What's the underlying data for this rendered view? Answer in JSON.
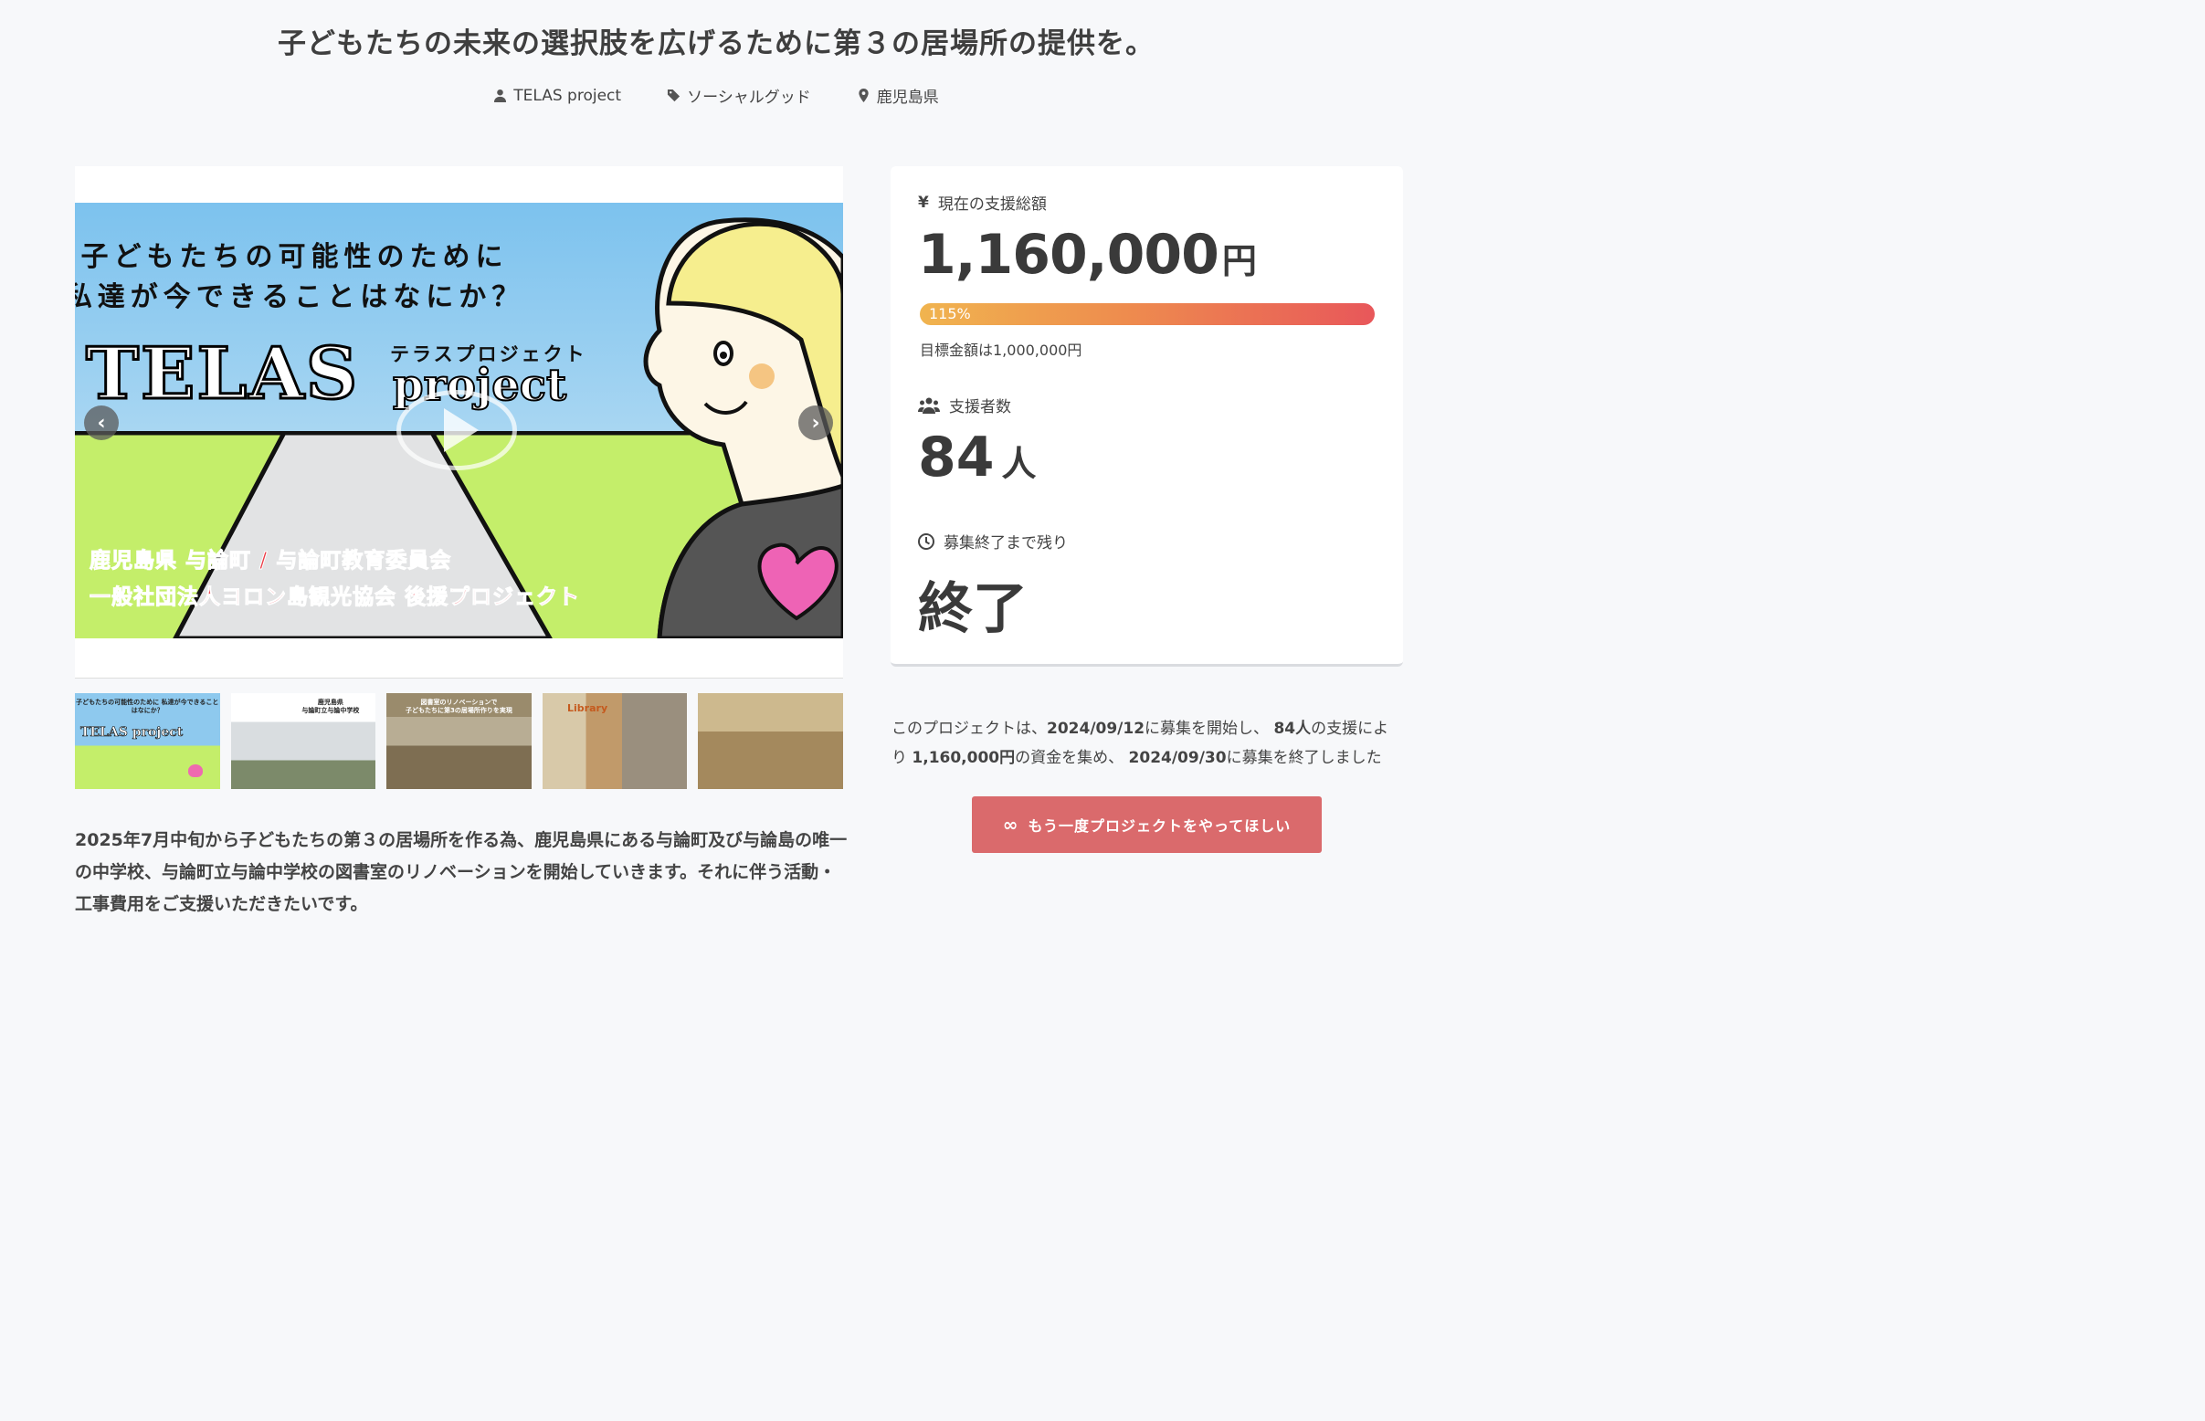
{
  "title": "子どもたちの未来の選択肢を広げるために第３の居場所の提供を。",
  "meta": {
    "owner": "TELAS project",
    "category": "ソーシャルグッド",
    "location": "鹿児島県"
  },
  "hero": {
    "line1": "子どもたちの可能性のために",
    "line2": "私達が今できることはなにか？",
    "logo_big": "TELAS",
    "logo_kana": "テラスプロジェクト",
    "logo_project": "project",
    "red_line1": "鹿児島県 与論町 / 与論町教育委員会",
    "red_line2": "一般社団法人ヨロン島観光協会 後援プロジェクト"
  },
  "thumbnails": {
    "t1_caption": "子どもたちの可能性のために 私達が今できることはなにか？",
    "t1_logo": "TELAS project",
    "t2_caption": "鹿児島県\n与論町立与論中学校",
    "t3_caption": "図書室のリノベーションで\n子どもたちに第3の居場所作りを実現",
    "t4_caption": "Library"
  },
  "description": "2025年7月中旬から子どもたちの第３の居場所を作る為、鹿児島県にある与論町及び与論島の唯一の中学校、与論町立与論中学校の図書室のリノベーションを開始していきます。それに伴う活動・工事費用をご支援いただきたいです。",
  "stats": {
    "amount_label": "現在の支援総額",
    "amount": "1,160,000",
    "amount_unit": "円",
    "progress_text": "115%",
    "progress_percent": 115,
    "goal": "目標金額は1,000,000円",
    "backers_label": "支援者数",
    "backers": "84",
    "backers_unit": "人",
    "remaining_label": "募集終了まで残り",
    "remaining": "終了"
  },
  "summary": {
    "p1": "このプロジェクトは、",
    "start_date": "2024/09/12",
    "p2": "に募集を開始し、",
    "backers": "84人",
    "p3": "の支援により",
    "amount": "1,160,000円",
    "p4": "の資金を集め、",
    "end_date": "2024/09/30",
    "p5": "に募集を終了しました"
  },
  "again_button": {
    "icon": "∞",
    "label": "もう一度プロジェクトをやってほしい"
  },
  "icons": {
    "owner": "user-icon",
    "category": "tag-icon",
    "location": "map-pin-icon",
    "amount": "yen-icon",
    "backers": "users-icon",
    "remaining": "clock-icon"
  },
  "colors": {
    "accent_button": "#da6a6c",
    "progress_start": "#f0b44f",
    "progress_end": "#e8575a"
  }
}
